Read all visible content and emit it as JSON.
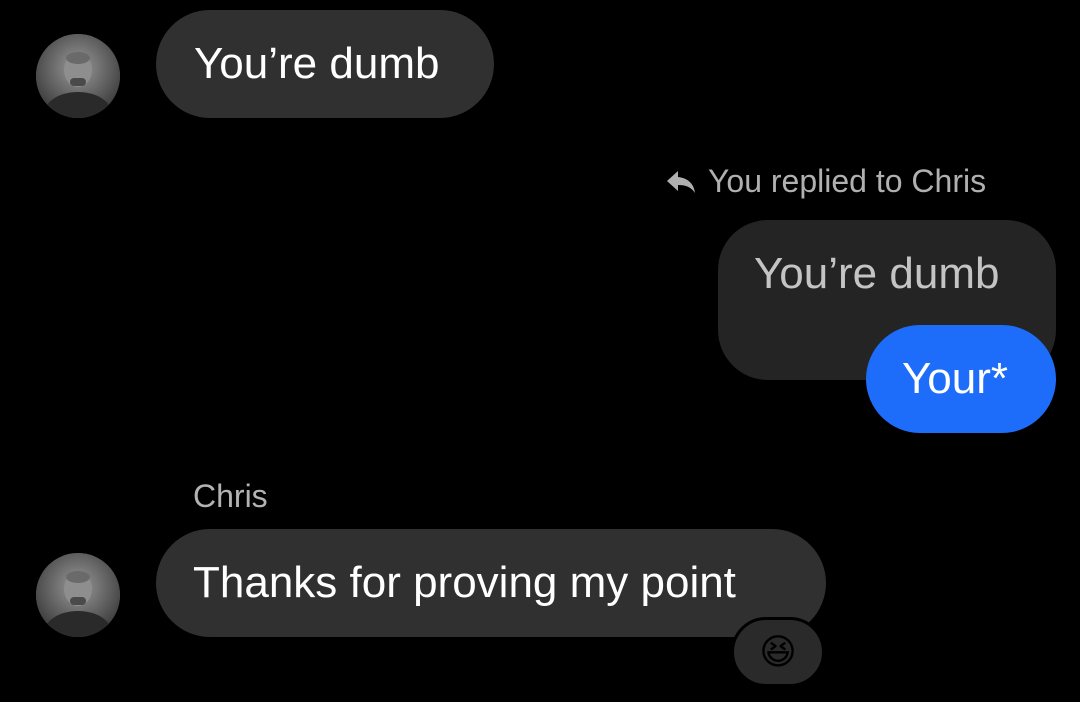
{
  "messages": {
    "first": {
      "text": "You’re dumb"
    },
    "reply_note": {
      "text": "You replied to Chris",
      "icon": "reply-arrow-icon"
    },
    "quoted": {
      "text": "You’re dumb"
    },
    "outgoing": {
      "text": "Your*"
    },
    "sender": {
      "name": "Chris"
    },
    "second": {
      "text": "Thanks for proving my point"
    },
    "reaction": {
      "emoji": "😆"
    }
  },
  "colors": {
    "background": "#000000",
    "incoming_bubble": "#303030",
    "quoted_bubble": "#242424",
    "outgoing_bubble": "#1d6dfa",
    "secondary_text": "#b0b0b0"
  }
}
